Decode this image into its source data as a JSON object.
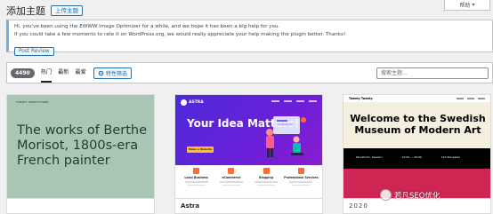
{
  "header": {
    "title": "添加主题",
    "upload_label": "上传主题"
  },
  "help_tab": {
    "label": "帮助",
    "arrow": "▾"
  },
  "notice": {
    "line1": "Hi, you've been using the EWWW Image Optimizer for a while, and we hope it has been a big help for you.",
    "line2": "If you could take a few moments to rate it on WordPress.org, we would really appreciate your help making the plugin better. Thanks!",
    "button": "Post Review"
  },
  "filters": {
    "count": "4490",
    "tabs": [
      {
        "label": "热门",
        "active": true
      },
      {
        "label": "最新",
        "active": false
      },
      {
        "label": "最爱",
        "active": false
      }
    ],
    "feature_filter_label": "特性筛选",
    "search_placeholder": "搜索主题..."
  },
  "themes": [
    {
      "name": "",
      "screenshot": {
        "site_name": "TWENTY TWENTY-THREE",
        "headline": "The works of Berthe Morisot, 1800s-era French painter"
      }
    },
    {
      "name": "Astra",
      "screenshot": {
        "brand": "ASTRA",
        "headline": "Your Idea Matters!",
        "cta": "Make a Website",
        "features": [
          "Local Business",
          "eCommerce",
          "Blogging",
          "Professional Services"
        ]
      }
    },
    {
      "name": "2020",
      "screenshot": {
        "brand": "Twenty Twenty",
        "headline": "Welcome to the Swedish Museum of Modern Art",
        "info": [
          "Stockholm, Sweden",
          "10:00 — 20:00",
          "123 Storgatan"
        ]
      }
    }
  ],
  "watermark": {
    "text": "若凡SEO优化"
  },
  "colors": {
    "accent": "#2271b1",
    "notice_border": "#72aee6",
    "astra_purple": "#5b24d9",
    "tt_pink": "#cd2653",
    "tt3_green": "#a9c6b5"
  }
}
